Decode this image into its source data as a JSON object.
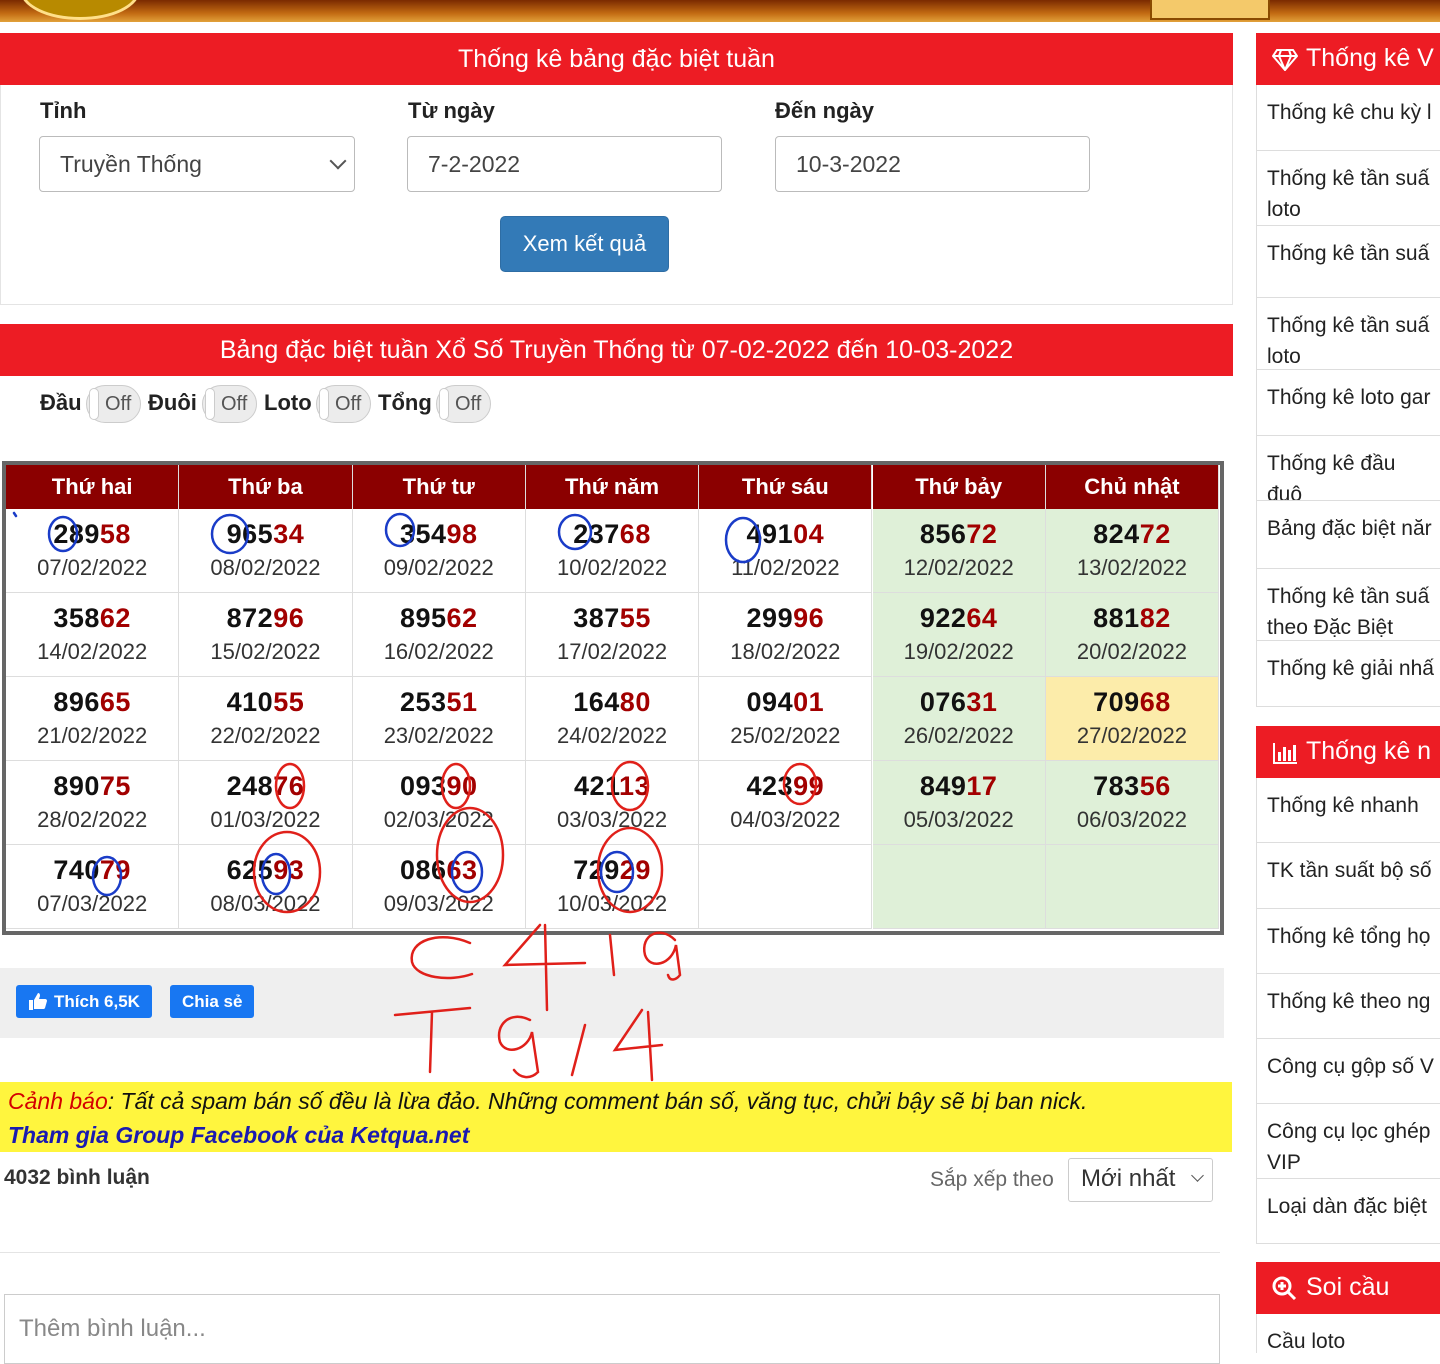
{
  "filter": {
    "title": "Thống kê bảng đặc biệt tuần",
    "province_label": "Tỉnh",
    "province_value": "Truyền Thống",
    "from_label": "Từ ngày",
    "from_value": "7-2-2022",
    "to_label": "Đến ngày",
    "to_value": "10-3-2022",
    "submit_label": "Xem kết quả"
  },
  "table": {
    "title": "Bảng đặc biệt tuần Xổ Số Truyền Thống từ 07-02-2022 đến 10-03-2022",
    "toggles": [
      {
        "label": "Đầu",
        "state": "Off"
      },
      {
        "label": "Đuôi",
        "state": "Off"
      },
      {
        "label": "Loto",
        "state": "Off"
      },
      {
        "label": "Tổng",
        "state": "Off"
      }
    ],
    "headers": [
      "Thứ hai",
      "Thứ ba",
      "Thứ tư",
      "Thứ năm",
      "Thứ sáu",
      "Thứ bảy",
      "Chủ nhật"
    ],
    "rows": [
      [
        {
          "head": "289",
          "tail": "58",
          "date": "07/02/2022"
        },
        {
          "head": "965",
          "tail": "34",
          "date": "08/02/2022"
        },
        {
          "head": "354",
          "tail": "98",
          "date": "09/02/2022"
        },
        {
          "head": "237",
          "tail": "68",
          "date": "10/02/2022"
        },
        {
          "head": "491",
          "tail": "04",
          "date": "11/02/2022"
        },
        {
          "head": "856",
          "tail": "72",
          "date": "12/02/2022"
        },
        {
          "head": "824",
          "tail": "72",
          "date": "13/02/2022"
        }
      ],
      [
        {
          "head": "358",
          "tail": "62",
          "date": "14/02/2022"
        },
        {
          "head": "872",
          "tail": "96",
          "date": "15/02/2022"
        },
        {
          "head": "895",
          "tail": "62",
          "date": "16/02/2022"
        },
        {
          "head": "387",
          "tail": "55",
          "date": "17/02/2022"
        },
        {
          "head": "299",
          "tail": "96",
          "date": "18/02/2022"
        },
        {
          "head": "922",
          "tail": "64",
          "date": "19/02/2022"
        },
        {
          "head": "881",
          "tail": "82",
          "date": "20/02/2022"
        }
      ],
      [
        {
          "head": "896",
          "tail": "65",
          "date": "21/02/2022"
        },
        {
          "head": "410",
          "tail": "55",
          "date": "22/02/2022"
        },
        {
          "head": "253",
          "tail": "51",
          "date": "23/02/2022"
        },
        {
          "head": "164",
          "tail": "80",
          "date": "24/02/2022"
        },
        {
          "head": "094",
          "tail": "01",
          "date": "25/02/2022"
        },
        {
          "head": "076",
          "tail": "31",
          "date": "26/02/2022"
        },
        {
          "head": "709",
          "tail": "68",
          "date": "27/02/2022"
        }
      ],
      [
        {
          "head": "890",
          "tail": "75",
          "date": "28/02/2022"
        },
        {
          "head": "248",
          "tail": "76",
          "date": "01/03/2022"
        },
        {
          "head": "093",
          "tail": "90",
          "date": "02/03/2022"
        },
        {
          "head": "421",
          "tail": "13",
          "date": "03/03/2022"
        },
        {
          "head": "423",
          "tail": "99",
          "date": "04/03/2022"
        },
        {
          "head": "849",
          "tail": "17",
          "date": "05/03/2022"
        },
        {
          "head": "783",
          "tail": "56",
          "date": "06/03/2022"
        }
      ],
      [
        {
          "head": "740",
          "tail": "79",
          "date": "07/03/2022"
        },
        {
          "head": "625",
          "tail": "93",
          "date": "08/03/2022"
        },
        {
          "head": "086",
          "tail": "63",
          "date": "09/03/2022"
        },
        {
          "head": "729",
          "tail": "29",
          "date": "10/03/2022"
        },
        {
          "head": "",
          "tail": "",
          "date": ""
        },
        {
          "head": "",
          "tail": "",
          "date": ""
        },
        {
          "head": "",
          "tail": "",
          "date": ""
        }
      ]
    ]
  },
  "social": {
    "like_label": "Thích 6,5K",
    "share_label": "Chia sẻ"
  },
  "warning": {
    "prefix": "Cảnh báo",
    "text": ": Tất cả spam bán số đều là lừa đảo. Những comment bán số, văng tục, chửi bậy sẽ bị ban nick.",
    "group_link": "Tham gia Group Facebook của Ketqua.net"
  },
  "comments": {
    "count_label": "4032 bình luận",
    "sort_label": "Sắp xếp theo",
    "sort_value": "Mới nhất",
    "placeholder": "Thêm bình luận..."
  },
  "sidebar": {
    "vip_title": "Thống kê V",
    "vip_items": [
      "Thống kê chu kỳ l",
      "Thống kê tần suấ loto",
      "Thống kê tần suấ",
      "Thống kê tần suấ loto",
      "Thống kê loto gar",
      "Thống kê đầu đuô",
      "Bảng đặc biệt năr",
      "Thống kê tần suấ theo Đặc Biệt",
      "Thống kê giải nhấ"
    ],
    "stats_title": "Thống kê n",
    "stats_items": [
      "Thống kê nhanh",
      "TK tần suất bộ số",
      "Thống kê tổng họ",
      "Thống kê theo ng",
      "Công cụ gộp số V",
      "Công cụ lọc ghép VIP",
      "Loại dàn đặc biệt"
    ],
    "soi_title": "Soi cầu",
    "soi_items": [
      "Cầu loto"
    ]
  },
  "handwriting": {
    "line1": "C 4 1 9",
    "line2": "T 9 1 4"
  },
  "colors": {
    "brand_red": "#ed1c24",
    "header_dark_red": "#8b0000",
    "weekend_green": "#dff0d8",
    "highlight_yellow": "#fcecaa",
    "ink_blue": "#1a3cc8",
    "ink_red": "#e0201a"
  }
}
